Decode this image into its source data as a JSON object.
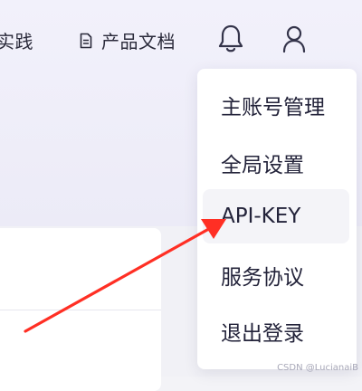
{
  "topbar": {
    "nav_best_practice": "实践",
    "nav_docs": "产品文档"
  },
  "icons": {
    "doc": "document-icon",
    "bell": "bell-icon",
    "user": "user-icon"
  },
  "dropdown": {
    "items": [
      {
        "label": "主账号管理"
      },
      {
        "label": "全局设置"
      },
      {
        "label": "API-KEY"
      },
      {
        "label": "服务协议"
      },
      {
        "label": "退出登录"
      }
    ],
    "active_index": 2
  },
  "annotation": {
    "arrow_color": "#ff2f24"
  },
  "watermark": "CSDN @LucianaiB"
}
